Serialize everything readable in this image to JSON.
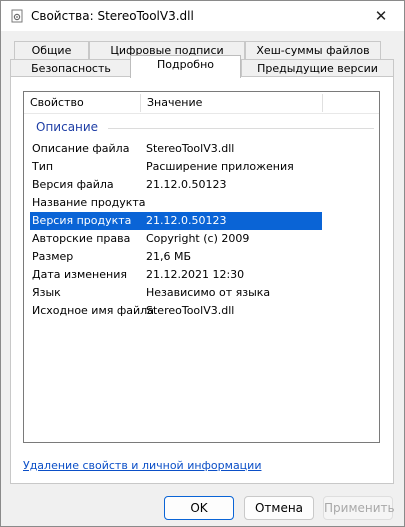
{
  "window": {
    "title": "Свойства: StereoToolV3.dll",
    "close_glyph": "✕"
  },
  "tabs": {
    "row1": [
      "Общие",
      "Цифровые подписи",
      "Хеш-суммы файлов"
    ],
    "row2": [
      "Безопасность",
      "Подробно",
      "Предыдущие версии"
    ],
    "active": "Подробно"
  },
  "details": {
    "columns": [
      "Свойство",
      "Значение"
    ],
    "group": "Описание",
    "rows": [
      {
        "key": "Описание файла",
        "value": "StereoToolV3.dll"
      },
      {
        "key": "Тип",
        "value": "Расширение приложения"
      },
      {
        "key": "Версия файла",
        "value": "21.12.0.50123"
      },
      {
        "key": "Название продукта",
        "value": ""
      },
      {
        "key": "Версия продукта",
        "value": "21.12.0.50123"
      },
      {
        "key": "Авторские права",
        "value": "Copyright (c) 2009"
      },
      {
        "key": "Размер",
        "value": "21,6 МБ"
      },
      {
        "key": "Дата изменения",
        "value": "21.12.2021 12:30"
      },
      {
        "key": "Язык",
        "value": "Независимо от языка"
      },
      {
        "key": "Исходное имя файла",
        "value": "StereoToolV3.dll"
      }
    ],
    "selected_row": 4
  },
  "link": "Удаление свойств и личной информации",
  "buttons": {
    "ok": "OK",
    "cancel": "Отмена",
    "apply": "Применить"
  },
  "colors": {
    "selection": "#0a64d6",
    "link": "#0b4fc7",
    "group_label": "#1f3fa6"
  }
}
